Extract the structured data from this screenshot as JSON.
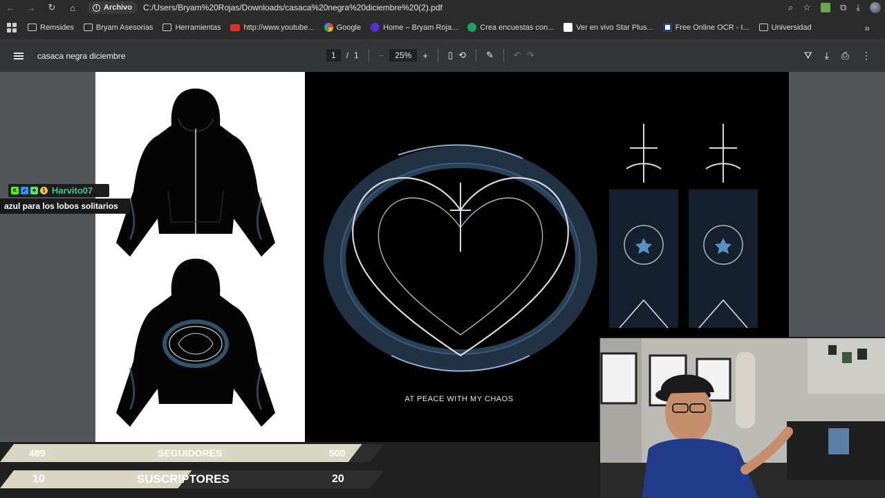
{
  "browser": {
    "site_chip": "Archivo",
    "url": "C:/Users/Bryam%20Rojas/Downloads/casaca%20negra%20diciembre%20(2).pdf",
    "bookmarks": [
      {
        "label": "Remsides",
        "icon": "folder-icon"
      },
      {
        "label": "Bryam Asesorias",
        "icon": "folder-icon"
      },
      {
        "label": "Herramientas",
        "icon": "folder-icon"
      },
      {
        "label": "http://www.youtube...",
        "icon": "youtube-icon"
      },
      {
        "label": "Google",
        "icon": "google-icon"
      },
      {
        "label": "Home – Bryam Roja...",
        "icon": "site-icon"
      },
      {
        "label": "Crea encuestas con...",
        "icon": "forms-icon"
      },
      {
        "label": "Ver en vivo Star Plus...",
        "icon": "page-icon"
      },
      {
        "label": "Free Online OCR - I...",
        "icon": "ocr-icon"
      },
      {
        "label": "Universidad",
        "icon": "folder-icon"
      }
    ]
  },
  "pdf": {
    "title": "casaca negra diciembre",
    "page_current": "1",
    "page_sep": "/",
    "page_total": "1",
    "zoom": "25%",
    "artwork_tagline": "AT PEACE WITH MY CHAOS"
  },
  "chat": {
    "username": "Harvito07",
    "message": "azul para los lobos solitarios"
  },
  "stats": {
    "followers": {
      "current": "489",
      "label": "SEGUIDORES",
      "goal": "500",
      "progress": 0.978
    },
    "subscribers": {
      "current": "10",
      "label": "SUSCRIPTORES",
      "goal": "20",
      "progress": 0.5
    }
  },
  "colors": {
    "accent_blue": "#5b8fbf",
    "chat_name": "#35d07f",
    "stat_fill": "#d9d6c3",
    "stat_bg": "#2e2e2e"
  }
}
